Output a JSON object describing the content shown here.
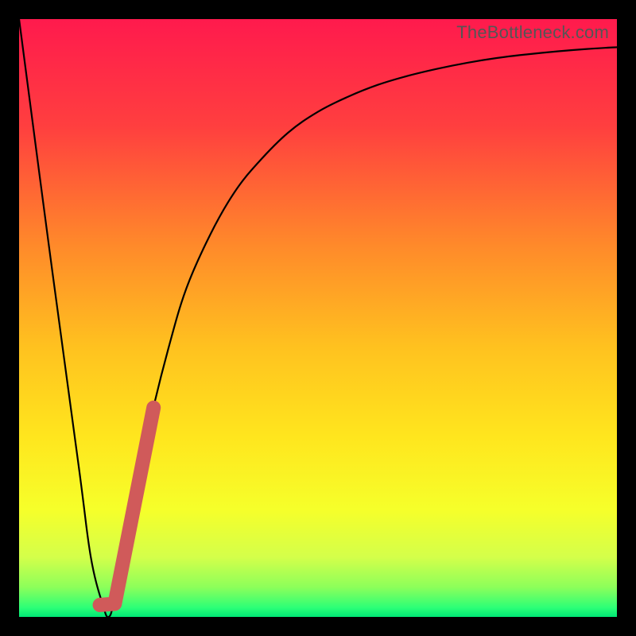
{
  "watermark": "TheBottleneck.com",
  "colors": {
    "frame": "#000000",
    "gradient_stops": [
      {
        "offset": 0.0,
        "color": "#ff1a4d"
      },
      {
        "offset": 0.18,
        "color": "#ff3f3f"
      },
      {
        "offset": 0.38,
        "color": "#ff8a2a"
      },
      {
        "offset": 0.55,
        "color": "#ffc21f"
      },
      {
        "offset": 0.7,
        "color": "#ffe61e"
      },
      {
        "offset": 0.82,
        "color": "#f6ff2a"
      },
      {
        "offset": 0.9,
        "color": "#d4ff4a"
      },
      {
        "offset": 0.95,
        "color": "#8dff5a"
      },
      {
        "offset": 0.985,
        "color": "#2bff77"
      },
      {
        "offset": 1.0,
        "color": "#00e676"
      }
    ],
    "curve": "#000000",
    "marker": "#d05a5a"
  },
  "chart_data": {
    "type": "line",
    "title": "",
    "xlabel": "",
    "ylabel": "",
    "xlim": [
      0,
      100
    ],
    "ylim": [
      0,
      100
    ],
    "series": [
      {
        "name": "bottleneck-curve",
        "x": [
          0,
          5,
          10,
          12,
          14,
          15,
          16,
          18,
          20,
          22,
          25,
          28,
          32,
          36,
          40,
          45,
          50,
          55,
          60,
          65,
          70,
          75,
          80,
          85,
          90,
          95,
          100
        ],
        "y": [
          100,
          62,
          25,
          10,
          2,
          0,
          3,
          12,
          23,
          33,
          45,
          55,
          64,
          71,
          76,
          81,
          84.5,
          87,
          89,
          90.5,
          91.7,
          92.7,
          93.5,
          94.1,
          94.6,
          95.0,
          95.3
        ]
      }
    ],
    "markers": [
      {
        "name": "highlight-segment",
        "shape": "thick-line",
        "points": [
          {
            "x": 13.5,
            "y": 2.0
          },
          {
            "x": 16.0,
            "y": 2.2
          },
          {
            "x": 22.5,
            "y": 35.0
          }
        ]
      }
    ]
  }
}
